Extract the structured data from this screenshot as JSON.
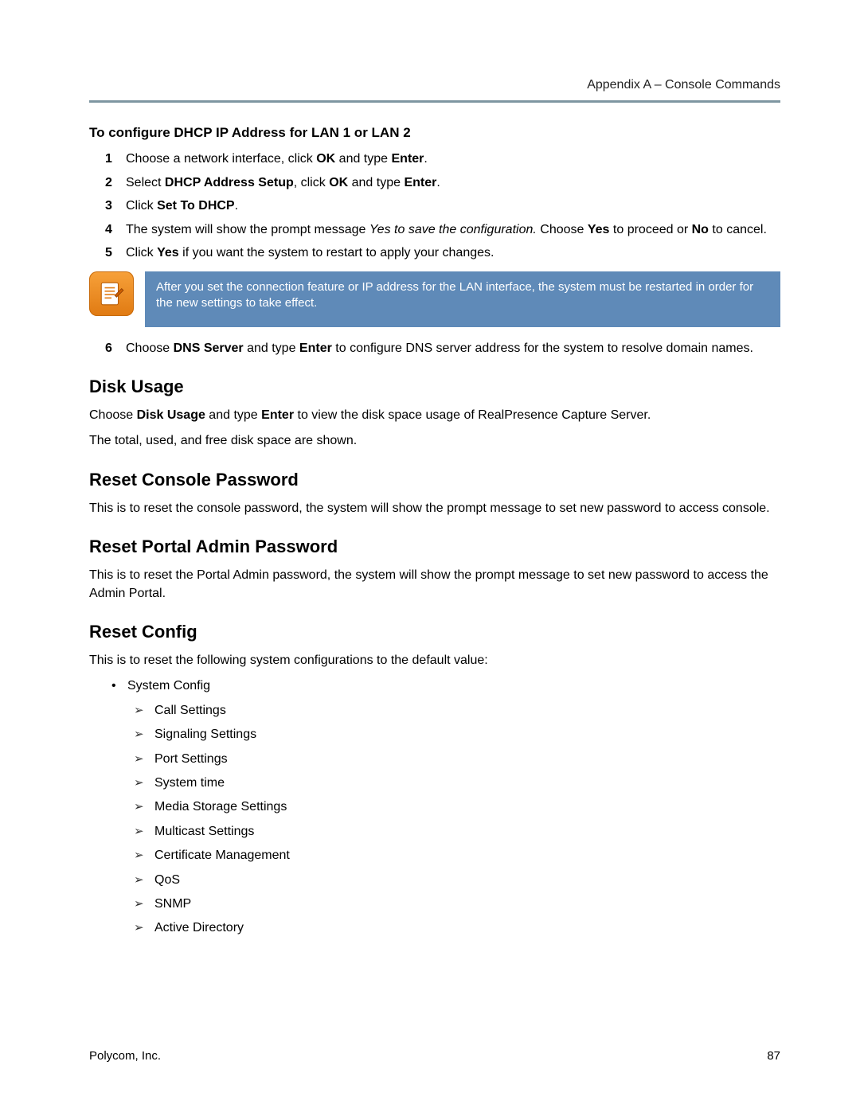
{
  "header": {
    "running_head": "Appendix A – Console Commands"
  },
  "proc": {
    "title": "To configure DHCP IP Address for LAN 1 or LAN 2",
    "steps": [
      {
        "n": "1",
        "segs": [
          {
            "t": "Choose a network interface, click "
          },
          {
            "t": "OK",
            "b": true
          },
          {
            "t": " and type "
          },
          {
            "t": "Enter",
            "b": true
          },
          {
            "t": "."
          }
        ]
      },
      {
        "n": "2",
        "segs": [
          {
            "t": "Select "
          },
          {
            "t": "DHCP Address Setup",
            "b": true
          },
          {
            "t": ", click "
          },
          {
            "t": "OK",
            "b": true
          },
          {
            "t": " and type "
          },
          {
            "t": "Enter",
            "b": true
          },
          {
            "t": "."
          }
        ]
      },
      {
        "n": "3",
        "segs": [
          {
            "t": "Click "
          },
          {
            "t": "Set To DHCP",
            "b": true
          },
          {
            "t": "."
          }
        ]
      },
      {
        "n": "4",
        "segs": [
          {
            "t": "The system will show the prompt message "
          },
          {
            "t": "Yes to save the configuration.",
            "i": true
          },
          {
            "t": " Choose "
          },
          {
            "t": "Yes",
            "b": true
          },
          {
            "t": " to proceed or "
          },
          {
            "t": "No",
            "b": true
          },
          {
            "t": " to cancel."
          }
        ]
      },
      {
        "n": "5",
        "segs": [
          {
            "t": "Click "
          },
          {
            "t": "Yes",
            "b": true
          },
          {
            "t": " if you want the system to restart to apply your changes."
          }
        ]
      }
    ],
    "note": "After you set the connection feature or IP address for the LAN interface, the system must be restarted in order for the new settings to take effect.",
    "step6": {
      "n": "6",
      "segs": [
        {
          "t": "Choose "
        },
        {
          "t": "DNS Server",
          "b": true
        },
        {
          "t": " and type "
        },
        {
          "t": "Enter",
          "b": true
        },
        {
          "t": " to configure DNS server address for the system to resolve domain names."
        }
      ]
    }
  },
  "sections": {
    "disk_usage": {
      "title": "Disk Usage",
      "p1_segs": [
        {
          "t": "Choose "
        },
        {
          "t": "Disk Usage",
          "b": true
        },
        {
          "t": " and type "
        },
        {
          "t": "Enter",
          "b": true
        },
        {
          "t": " to view the disk space usage of RealPresence Capture Server."
        }
      ],
      "p2": "The total, used, and free disk space are shown."
    },
    "reset_console": {
      "title": "Reset Console Password",
      "p": "This is to reset the console password, the system will show the prompt message to set new password to access console."
    },
    "reset_portal": {
      "title": "Reset Portal Admin Password",
      "p": "This is to reset the Portal Admin password, the system will show the prompt message to set new password to access the Admin Portal."
    },
    "reset_config": {
      "title": "Reset Config",
      "p": "This is to reset the following system configurations to the default value:",
      "top_item": "System Config",
      "subs": [
        "Call Settings",
        "Signaling Settings",
        "Port Settings",
        "System time",
        "Media Storage Settings",
        "Multicast Settings",
        "Certificate Management",
        "QoS",
        "SNMP",
        "Active Directory"
      ]
    }
  },
  "footer": {
    "left": "Polycom, Inc.",
    "page": "87"
  }
}
